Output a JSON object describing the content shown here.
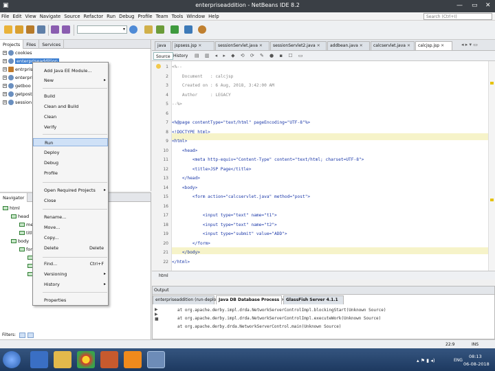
{
  "window": {
    "title": "enterpriseaddition - NetBeans IDE 8.2"
  },
  "menubar": {
    "items": [
      "File",
      "Edit",
      "View",
      "Navigate",
      "Source",
      "Refactor",
      "Run",
      "Debug",
      "Profile",
      "Team",
      "Tools",
      "Window",
      "Help"
    ]
  },
  "search": {
    "placeholder": "Search (Ctrl+I)"
  },
  "projects_pane": {
    "tabs": [
      "Projects",
      "Files",
      "Services"
    ],
    "items": [
      {
        "label": "cookies",
        "icon": "globe-icon"
      },
      {
        "label": "enterpriseaddition",
        "icon": "globe-icon"
      },
      {
        "label": "entrprise",
        "icon": "jar-icon"
      },
      {
        "label": "enterprise",
        "icon": "globe-icon"
      },
      {
        "label": "getboo",
        "icon": "globe-icon"
      },
      {
        "label": "getpost",
        "icon": "globe-icon"
      },
      {
        "label": "session",
        "icon": "globe-icon"
      }
    ]
  },
  "context_menu": {
    "items": [
      {
        "label": "Add Java EE Module...",
        "submenu": false,
        "shortcut": ""
      },
      {
        "label": "New",
        "submenu": true,
        "shortcut": ""
      },
      {
        "label": "Build",
        "submenu": false,
        "shortcut": ""
      },
      {
        "label": "Clean and Build",
        "submenu": false,
        "shortcut": ""
      },
      {
        "label": "Clean",
        "submenu": false,
        "shortcut": ""
      },
      {
        "label": "Verify",
        "submenu": false,
        "shortcut": ""
      },
      {
        "label": "Run",
        "submenu": false,
        "shortcut": "",
        "highlighted": true
      },
      {
        "label": "Deploy",
        "submenu": false,
        "shortcut": ""
      },
      {
        "label": "Debug",
        "submenu": false,
        "shortcut": ""
      },
      {
        "label": "Profile",
        "submenu": false,
        "shortcut": ""
      },
      {
        "label": "Open Required Projects",
        "submenu": true,
        "shortcut": ""
      },
      {
        "label": "Close",
        "submenu": false,
        "shortcut": ""
      },
      {
        "label": "Rename...",
        "submenu": false,
        "shortcut": ""
      },
      {
        "label": "Move...",
        "submenu": false,
        "shortcut": ""
      },
      {
        "label": "Copy...",
        "submenu": false,
        "shortcut": ""
      },
      {
        "label": "Delete",
        "submenu": false,
        "shortcut": "Delete"
      },
      {
        "label": "Find...",
        "submenu": false,
        "shortcut": "Ctrl+F"
      },
      {
        "label": "Versioning",
        "submenu": true,
        "shortcut": ""
      },
      {
        "label": "History",
        "submenu": true,
        "shortcut": ""
      },
      {
        "label": "Properties",
        "submenu": false,
        "shortcut": ""
      }
    ]
  },
  "navigator": {
    "title": "Navigator",
    "tree": [
      "html",
      "head",
      "meta",
      "title",
      "body",
      "form",
      "input",
      "input",
      "input"
    ],
    "filters_label": "Filters:"
  },
  "editor": {
    "tabs": [
      {
        "label": "java",
        "active": false
      },
      {
        "label": "jspsess.jsp",
        "active": false
      },
      {
        "label": "sessionServlet.java",
        "active": false
      },
      {
        "label": "sessionServlet2.java",
        "active": false
      },
      {
        "label": "addbean.java",
        "active": false
      },
      {
        "label": "calcservlet.java",
        "active": false
      },
      {
        "label": "calcjsp.jsp",
        "active": true
      }
    ],
    "view_buttons": [
      "Source",
      "History"
    ],
    "lines": [
      "<%--",
      "    Document   : calcjsp",
      "    Created on : 6 Aug, 2018, 3:42:00 AM",
      "    Author     : LEGACY",
      "--%>",
      "",
      "<%@page contentType=\"text/html\" pageEncoding=\"UTF-8\"%>",
      "<!DOCTYPE html>",
      "<html>",
      "    <head>",
      "        <meta http-equiv=\"Content-Type\" content=\"text/html; charset=UTF-8\">",
      "        <title>JSP Page</title>",
      "    </head>",
      "    <body>",
      "        <form action=\"calcservlet.java\" method=\"post\">",
      "",
      "            <input type=\"text\" name=\"t1\">",
      "            <input type=\"text\" name=\"t2\">",
      "            <input type=\"submit\" value=\"ADD\">",
      "        </form>",
      "    </body>",
      "</html>"
    ],
    "breadcrumb": "html"
  },
  "output": {
    "title": "Output",
    "tabs": [
      {
        "label": "enterpriseaddition (run-deploy)",
        "active": false
      },
      {
        "label": "Java DB Database Process",
        "active": true
      },
      {
        "label": "GlassFish Server 4.1.1",
        "active": false
      }
    ],
    "lines": [
      "at org.apache.derby.impl.drda.NetworkServerControlImpl.blockingStart(Unknown Source)",
      "at org.apache.derby.impl.drda.NetworkServerControlImpl.executeWork(Unknown Source)",
      "at org.apache.derby.drda.NetworkServerControl.main(Unknown Source)"
    ]
  },
  "status": {
    "position": "22:9",
    "mode": "INS"
  },
  "taskbar": {
    "time": "08:13",
    "date": "06-08-2018",
    "lang": "ENG"
  }
}
